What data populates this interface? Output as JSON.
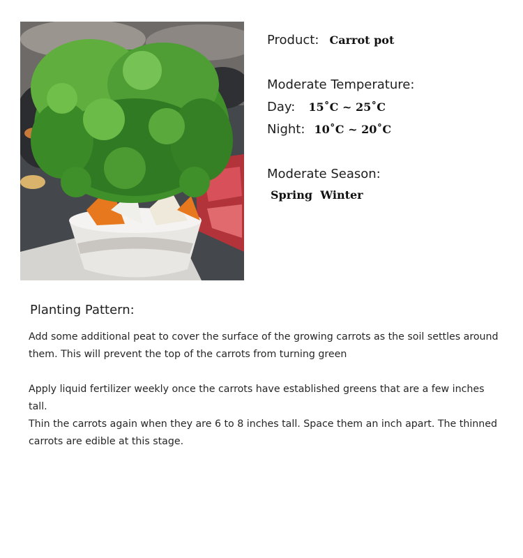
{
  "product": {
    "label": "Product:",
    "value": "Carrot pot"
  },
  "temperature": {
    "heading": "Moderate Temperature:",
    "day_label": "Day:",
    "day_value": "15˚C ~ 25˚C",
    "night_label": "Night:",
    "night_value": "10˚C ~ 20˚C"
  },
  "season": {
    "heading": "Moderate Season:",
    "value": "Spring  Winter"
  },
  "planting": {
    "title": "Planting Pattern:",
    "paragraphs": [
      "Add some additional peat to cover the surface of the growing carrots as the soil settles around them. This will prevent the top of the carrots from turning green",
      "Apply liquid fertilizer weekly once the carrots have established greens that are a few inches tall.",
      "Thin the carrots again when they are 6 to 8 inches tall. Space them an inch apart. The thinned carrots are edible at this stage."
    ]
  },
  "colors": {
    "leaf_green": "#3f8f2a",
    "carrot_orange": "#e8781e",
    "pot_white": "#e9e7e3",
    "meat_red": "#c23a3a"
  }
}
